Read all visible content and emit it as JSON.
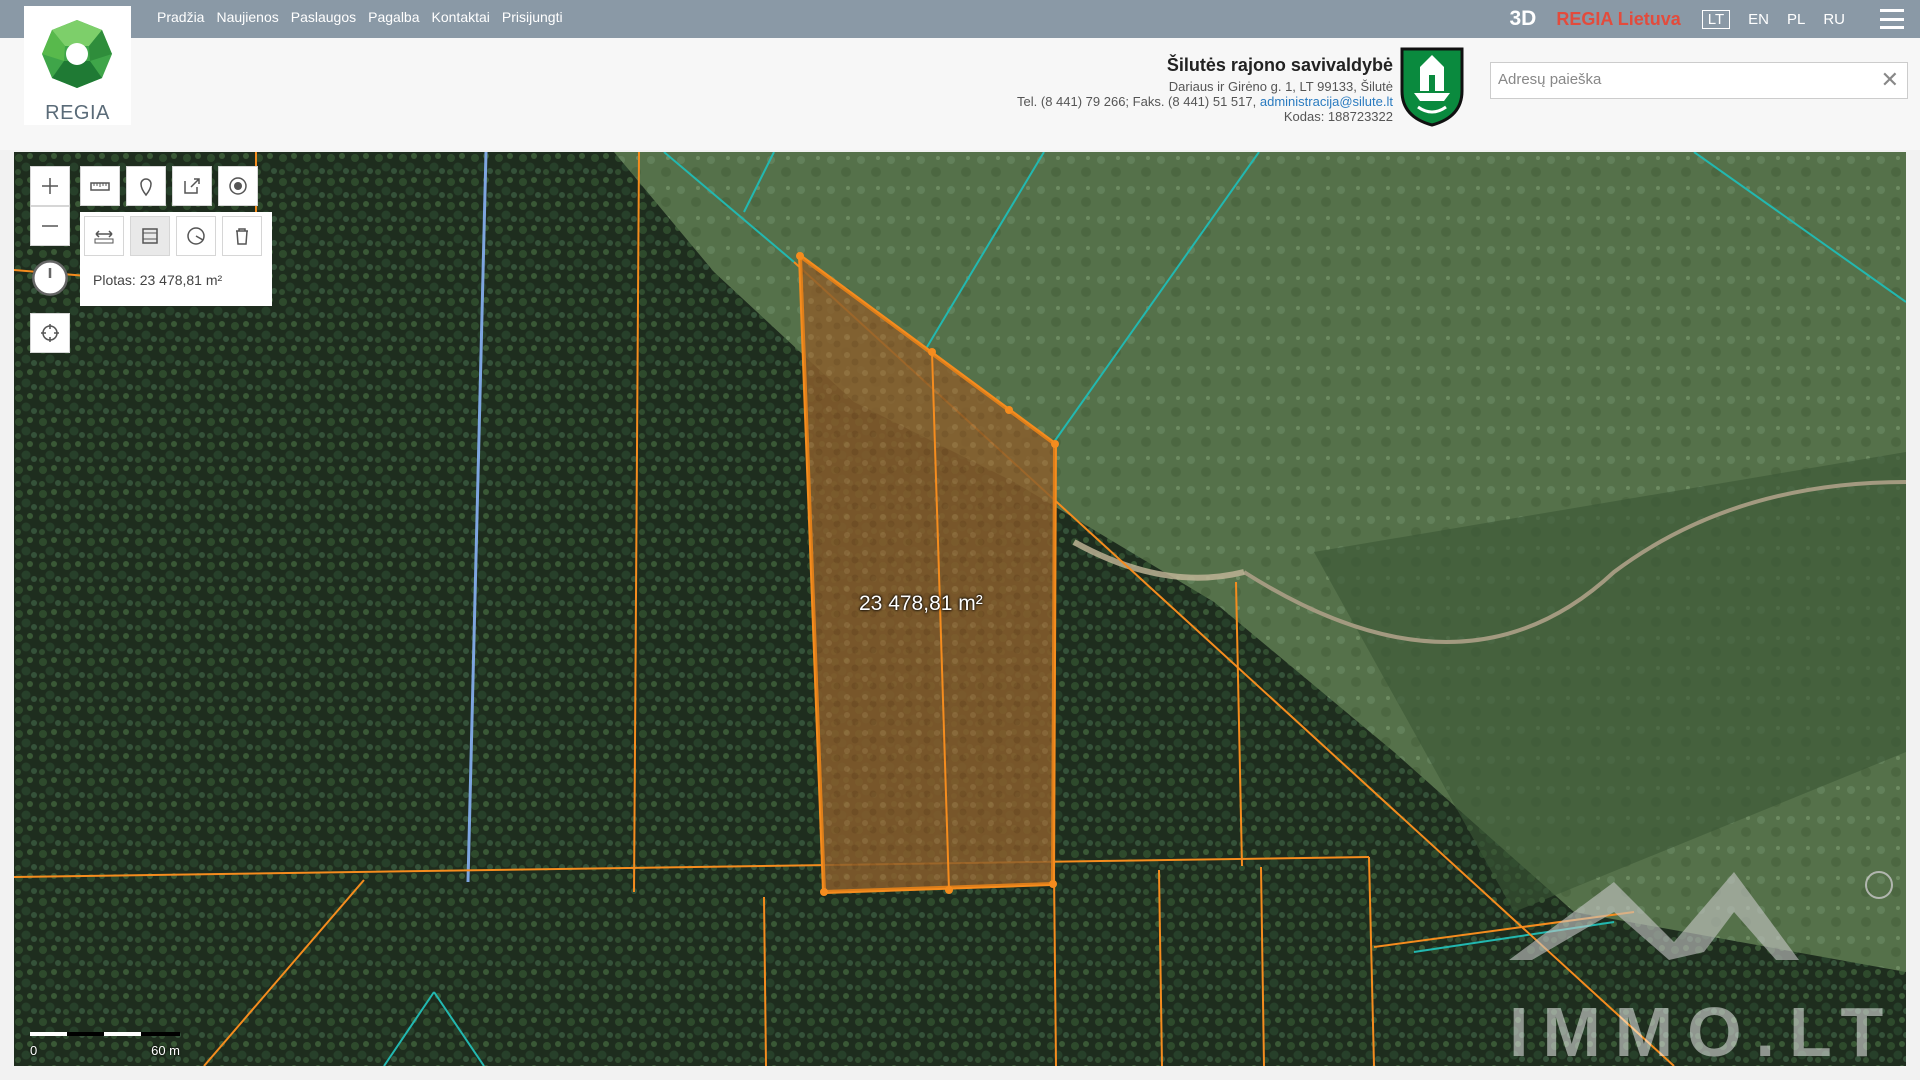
{
  "nav": {
    "items": [
      "Pradžia",
      "Naujienos",
      "Paslaugos",
      "Pagalba",
      "Kontaktai",
      "Prisijungti"
    ]
  },
  "logo": {
    "text": "REGIA"
  },
  "top_right": {
    "btn_3d": "3D",
    "regia_lt": "REGIA Lietuva",
    "langs": [
      "LT",
      "EN",
      "PL",
      "RU"
    ],
    "active_lang": "LT"
  },
  "municipality": {
    "title": "Šilutės rajono savivaldybė",
    "address": "Dariaus ir Girėno g. 1, LT 99133, Šilutė",
    "phone": "Tel. (8 441) 79 266; Faks. (8 441) 51 517,",
    "email": "administracija@silute.lt",
    "code": "Kodas: 188723322"
  },
  "search": {
    "placeholder": "Adresų paieška",
    "value": ""
  },
  "measure": {
    "area_text": "Plotas: 23 478,81 m²",
    "map_label": "23 478,81 m²"
  },
  "scale": {
    "start": "0",
    "end": "60 m"
  },
  "watermark": {
    "text": "IMMO.LT"
  },
  "colors": {
    "topbar": "#8a99a6",
    "parcel": "#f58c1e",
    "accent_red": "#e34b3c",
    "link": "#2a7bc0"
  }
}
